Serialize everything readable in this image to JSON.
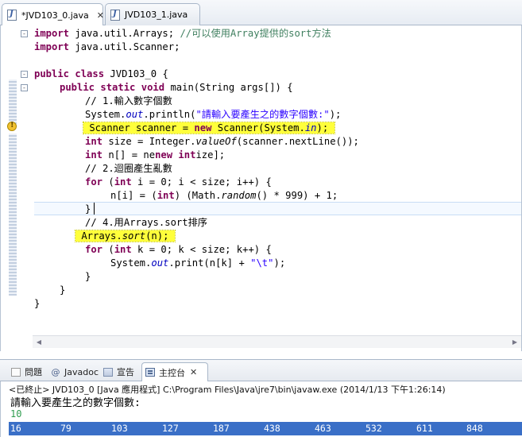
{
  "editor_tabs": [
    {
      "label": "*JVD103_0.java",
      "close": "✕",
      "active": true
    },
    {
      "label": "JVD103_1.java",
      "active": false
    }
  ],
  "code_lines": [
    [
      "import java.util.Arrays; //可以使用Array提供的sort方法"
    ],
    [
      "import java.util.Scanner;"
    ],
    [
      "public class JVD103_0 {"
    ],
    [
      "public static void main(String args[]) {"
    ],
    [
      "// 1.輸入數字個數"
    ],
    [
      "System.out.println(\"請輸入要產生之的數字個數:\");"
    ],
    [
      "Scanner scanner = new Scanner(System.in);"
    ],
    [
      "int size = Integer.valueOf(scanner.nextLine());"
    ],
    [
      "int n[] = new int[size];"
    ],
    [
      "// 2.迴圈產生亂數"
    ],
    [
      "for (int i = 0; i < size; i++) {"
    ],
    [
      "n[i] = (int) (Math.random() * 999) + 1;"
    ],
    [
      "}"
    ],
    [
      "// 4.用Arrays.sort排序"
    ],
    [
      "Arrays.sort(n);"
    ],
    [
      "for (int k = 0; k < size; k++) {"
    ],
    [
      "System.out.print(n[k] + \"\\t\");"
    ],
    [
      "}"
    ],
    [
      "}"
    ],
    [
      "}"
    ]
  ],
  "panel_tabs": [
    {
      "label": "問題",
      "icon": "problems-icon"
    },
    {
      "label": "Javadoc",
      "icon": "at-icon"
    },
    {
      "label": "宣告",
      "icon": "declaration-icon"
    },
    {
      "label": "主控台",
      "icon": "console-icon",
      "close": "✕",
      "active": true
    }
  ],
  "console": {
    "status": "<已終止> JVD103_0 [Java 應用程式] C:\\Program Files\\Java\\jre7\\bin\\javaw.exe (2014/1/13 下午1:26:14)",
    "prompt": "請輸入要產生之的數字個數:",
    "input": "10",
    "output": [
      "16",
      "79",
      "103",
      "127",
      "187",
      "438",
      "463",
      "532",
      "611",
      "848"
    ]
  },
  "colors": {
    "keyword": "#7f0055",
    "comment": "#3f7f5f",
    "string": "#2a00ff",
    "highlight": "#ffff3b",
    "console_input": "#2e9c4e",
    "selection": "#3a6fc7"
  }
}
